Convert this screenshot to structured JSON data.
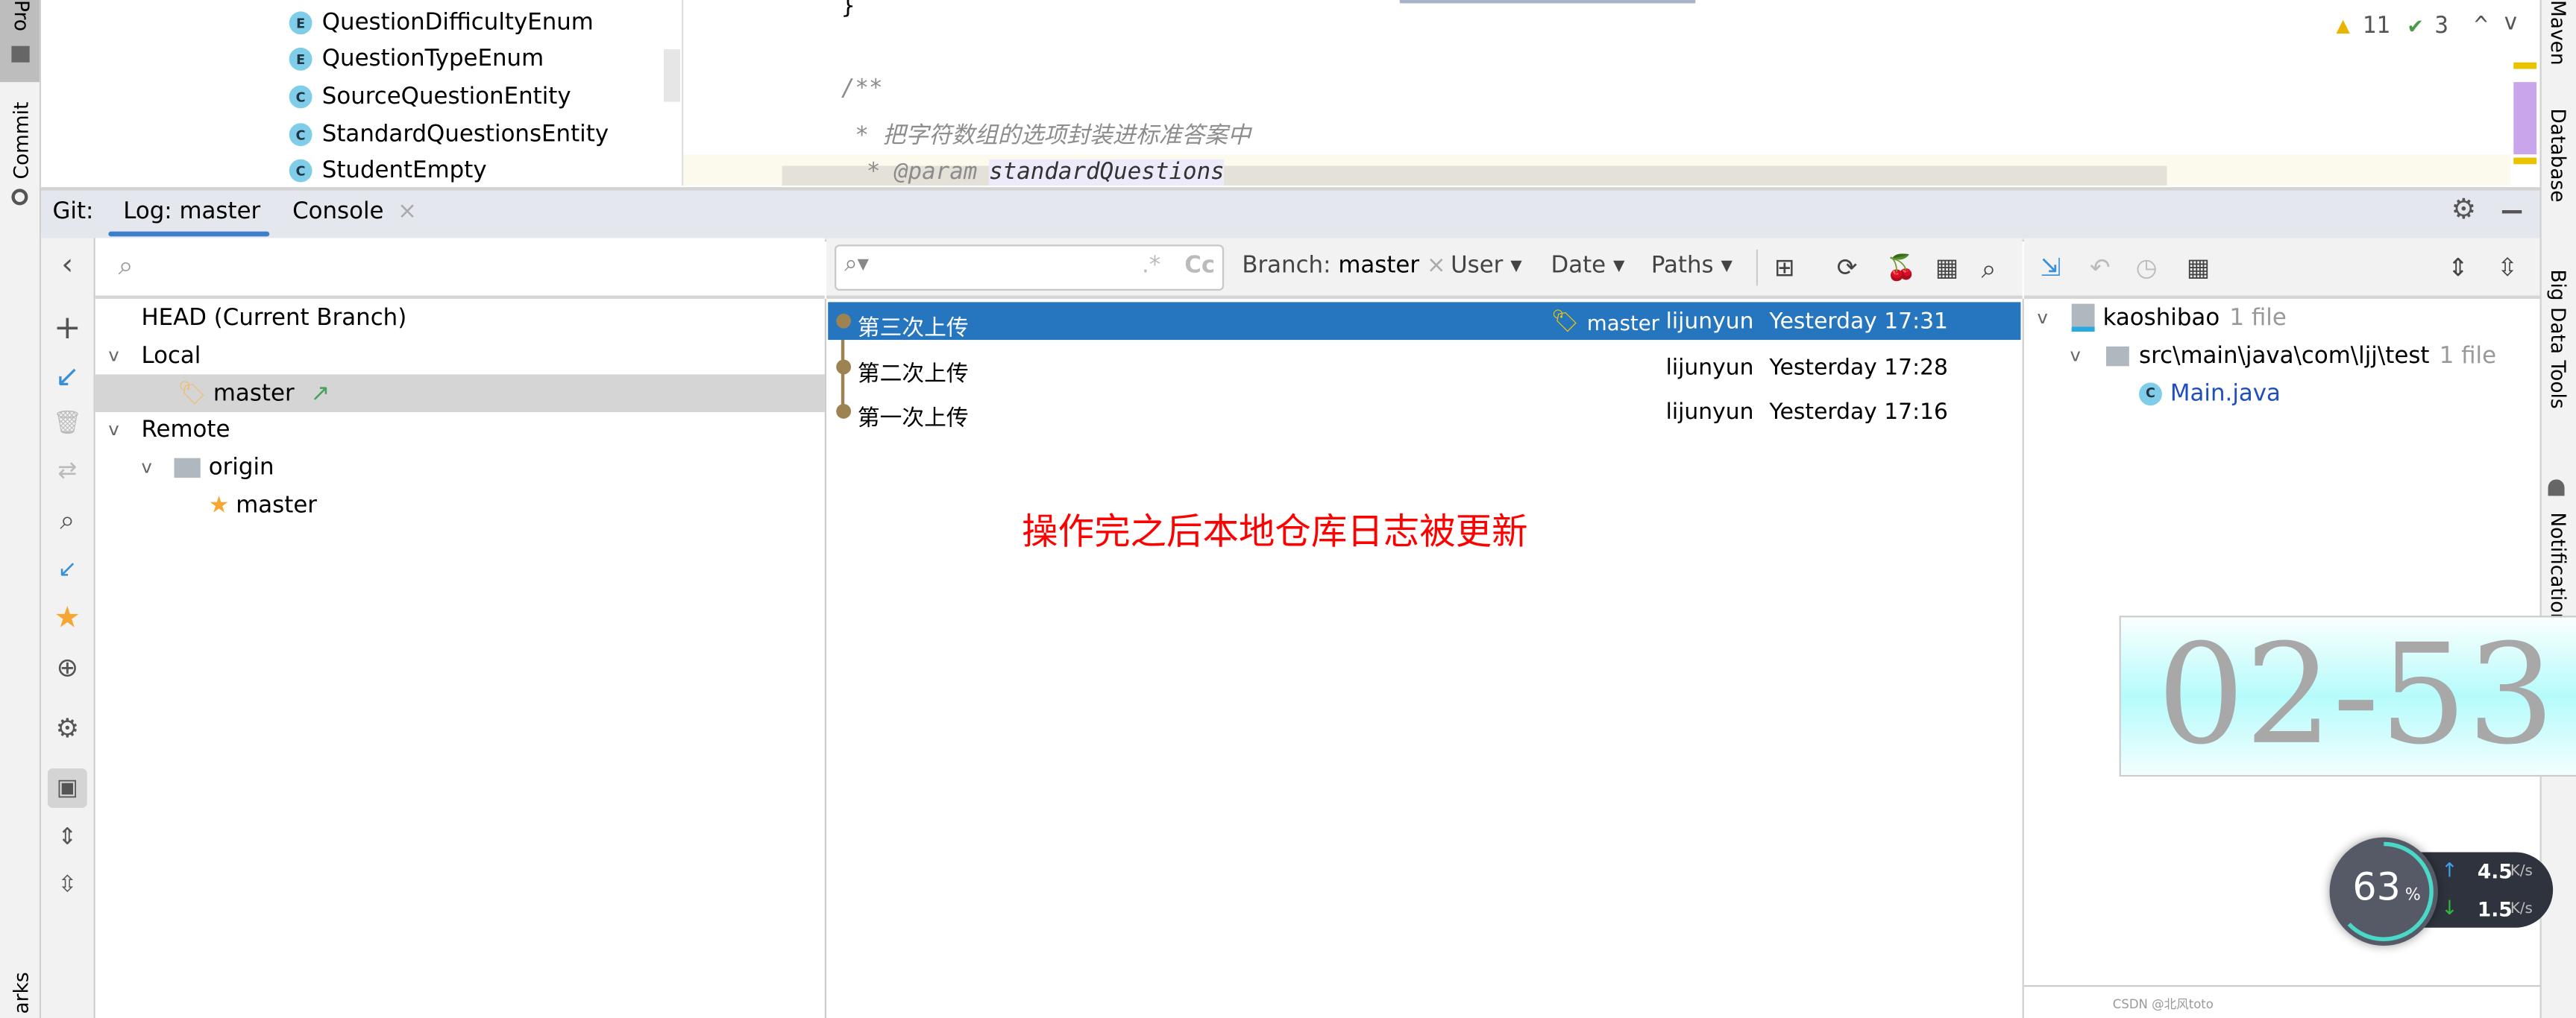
{
  "left_stripe": {
    "project_label": "Pro",
    "commit_label": "Commit",
    "bookmarks_label": "arks"
  },
  "right_stripe": {
    "maven": "Maven",
    "database": "Database",
    "big_data_tools": "Big Data Tools",
    "notifications": "Notifications"
  },
  "project_tree": {
    "items": [
      {
        "kind": "E",
        "label": "QuestionDifficultyEnum"
      },
      {
        "kind": "E",
        "label": "QuestionTypeEnum"
      },
      {
        "kind": "C",
        "label": "SourceQuestionEntity"
      },
      {
        "kind": "C",
        "label": "StandardQuestionsEntity"
      },
      {
        "kind": "C",
        "label": "StudentEmpty"
      }
    ]
  },
  "editor": {
    "lines": [
      "}",
      "/**",
      " * 把字符数组的选项封装进标准答案中",
      " * @param",
      "standardQuestions"
    ],
    "warnings_count": "11",
    "checks_count": "3"
  },
  "git_panel": {
    "title": "Git:",
    "tabs": [
      {
        "label": "Log: master",
        "active": true
      },
      {
        "label": "Console",
        "closable": true
      }
    ]
  },
  "branches": {
    "search_placeholder": "",
    "head": "HEAD (Current Branch)",
    "local": "Local",
    "local_master": "master",
    "remote": "Remote",
    "origin": "origin",
    "origin_master": "master"
  },
  "log_toolbar": {
    "filter_placeholder": "",
    "regex": ".*",
    "case": "Cc",
    "branch_label": "Branch:",
    "branch_value": "master",
    "user": "User",
    "date": "Date",
    "paths": "Paths"
  },
  "commits": [
    {
      "message": "第三次上传",
      "tag": "master",
      "author": "lijunyun",
      "date": "Yesterday 17:31",
      "selected": true
    },
    {
      "message": "第二次上传",
      "tag": "",
      "author": "lijunyun",
      "date": "Yesterday 17:28",
      "selected": false
    },
    {
      "message": "第一次上传",
      "tag": "",
      "author": "lijunyun",
      "date": "Yesterday 17:16",
      "selected": false
    }
  ],
  "annotation": "操作完之后本地仓库日志被更新",
  "changes": {
    "root": "kaoshibao",
    "root_count": "1 file",
    "dir": "src\\main\\java\\com\\ljj\\test",
    "dir_count": "1 file",
    "file": "Main.java"
  },
  "overlay_clock": "02-53",
  "net_widget": {
    "percent": "63",
    "percent_sign": "%",
    "up": "4.5",
    "down": "1.5",
    "unit": "K/s",
    "level": 0.63
  },
  "watermark": "CSDN @北风toto",
  "colors": {
    "selection": "#2675bf",
    "accent": "#3d7fc9",
    "graph": "#9c8351",
    "annotation": "#ff0000"
  }
}
